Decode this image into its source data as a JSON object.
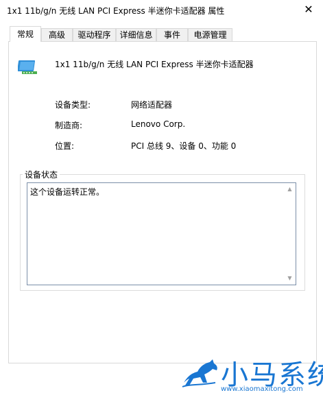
{
  "window": {
    "title": "1x1 11b/g/n 无线 LAN PCI Express 半迷你卡适配器 属性",
    "close_glyph": "✕"
  },
  "tabs": [
    {
      "label": "常规",
      "active": true
    },
    {
      "label": "高级"
    },
    {
      "label": "驱动程序"
    },
    {
      "label": "详细信息"
    },
    {
      "label": "事件"
    },
    {
      "label": "电源管理"
    }
  ],
  "device": {
    "name": "1x1 11b/g/n 无线 LAN PCI Express 半迷你卡适配器",
    "icon": "network-adapter-icon"
  },
  "properties": [
    {
      "label": "设备类型:",
      "value": "网络适配器"
    },
    {
      "label": "制造商:",
      "value": "Lenovo Corp."
    },
    {
      "label": "位置:",
      "value": "PCI 总线 9、设备 0、功能 0"
    }
  ],
  "status_group": {
    "title": "设备状态",
    "text": "这个设备运转正常。"
  },
  "watermark": {
    "brand": "小马系统",
    "url": "www.xiaomaxitong.com"
  },
  "colors": {
    "accent": "#1976d2",
    "border": "#d9d9d9",
    "field_border": "#7a8ea8"
  }
}
